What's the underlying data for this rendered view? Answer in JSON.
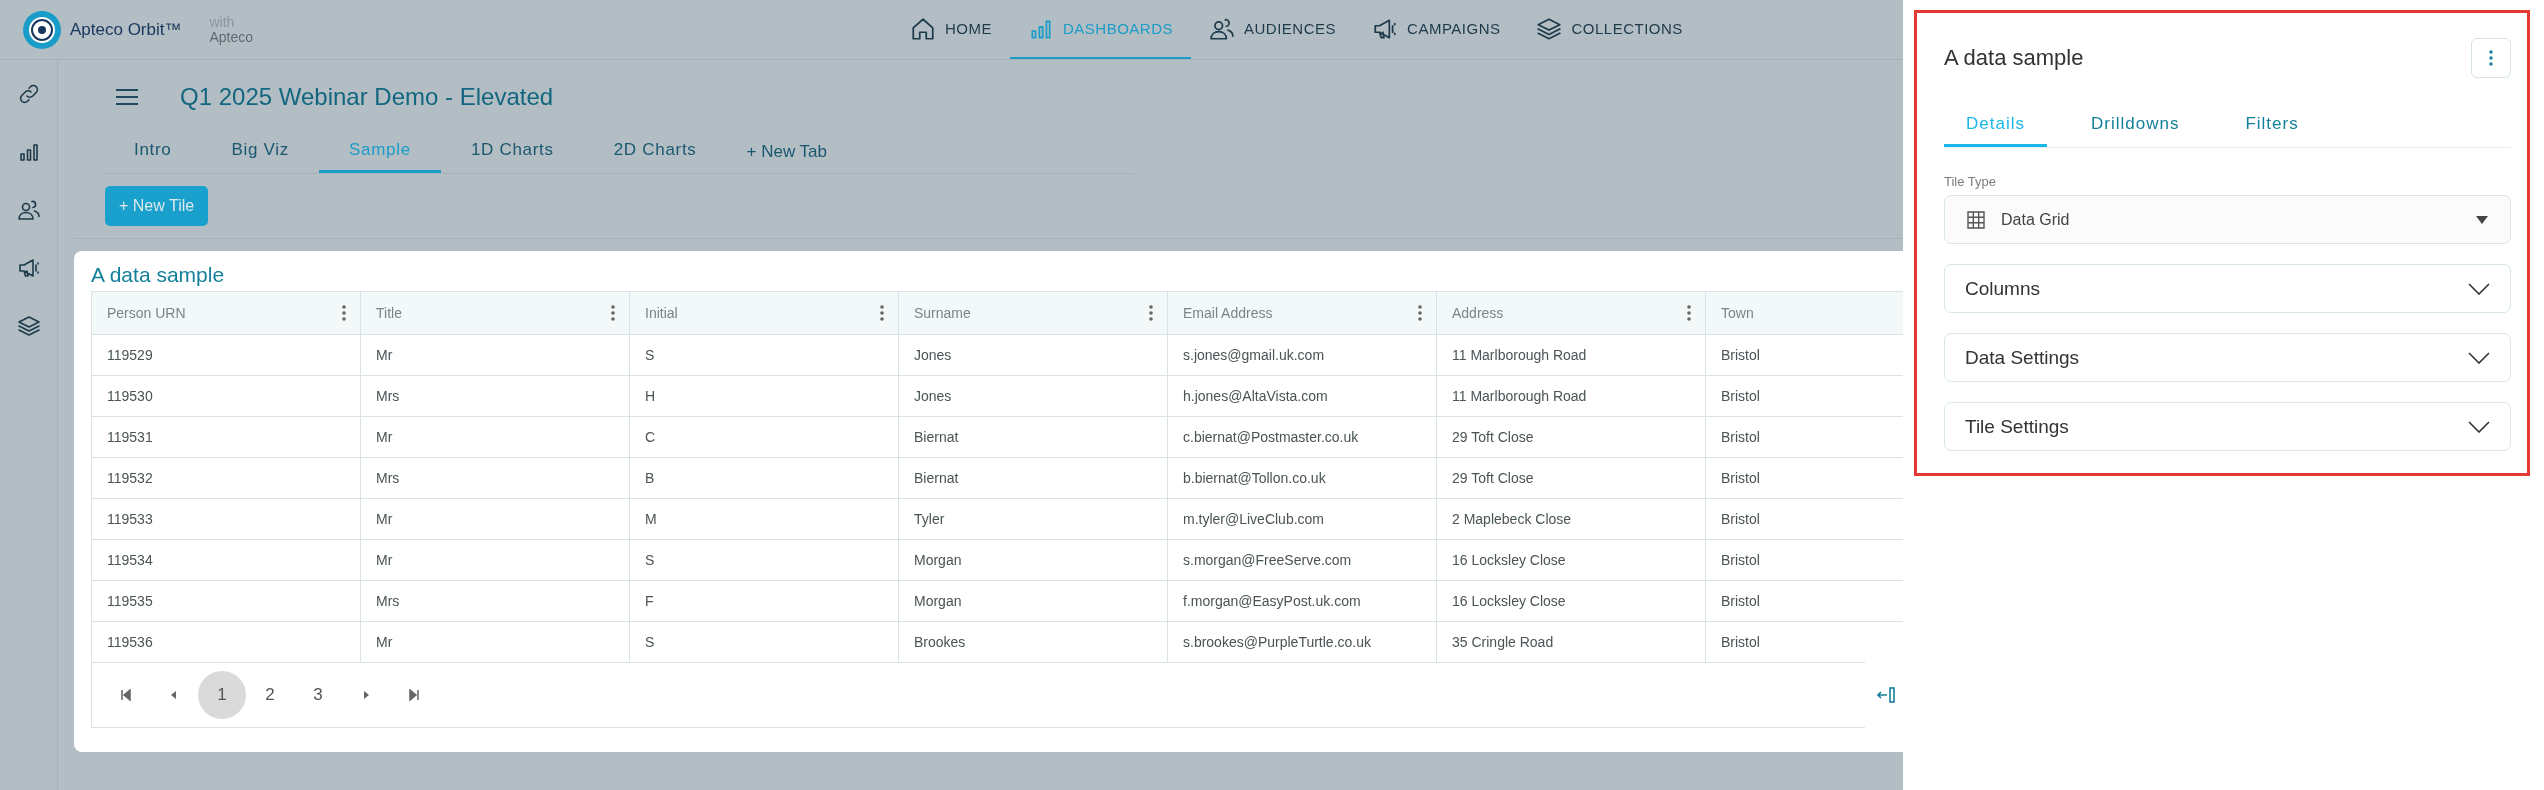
{
  "app": {
    "name": "Apteco Orbit™",
    "with_label": "with",
    "with_brand": "Apteco"
  },
  "nav": [
    {
      "label": "HOME",
      "selected": false
    },
    {
      "label": "DASHBOARDS",
      "selected": true
    },
    {
      "label": "AUDIENCES",
      "selected": false
    },
    {
      "label": "CAMPAIGNS",
      "selected": false
    },
    {
      "label": "COLLECTIONS",
      "selected": false
    }
  ],
  "dashboard": {
    "title": "Q1 2025 Webinar Demo - Elevated",
    "tabs": [
      {
        "label": "Intro",
        "selected": false
      },
      {
        "label": "Big Viz",
        "selected": false
      },
      {
        "label": "Sample",
        "selected": true
      },
      {
        "label": "1D Charts",
        "selected": false
      },
      {
        "label": "2D Charts",
        "selected": false
      }
    ],
    "new_tab": "+ New Tab",
    "new_tile_button": "+ New Tile"
  },
  "tile": {
    "title": "A data sample",
    "columns": [
      {
        "label": "Person URN",
        "menu": true
      },
      {
        "label": "Title",
        "menu": true
      },
      {
        "label": "Initial",
        "menu": true
      },
      {
        "label": "Surname",
        "menu": true
      },
      {
        "label": "Email Address",
        "menu": true
      },
      {
        "label": "Address",
        "menu": true
      },
      {
        "label": "Town",
        "menu": false
      }
    ],
    "rows": [
      [
        "119529",
        "Mr",
        "S",
        "Jones",
        "s.jones@gmail.uk.com",
        "11 Marlborough Road",
        "Bristol"
      ],
      [
        "119530",
        "Mrs",
        "H",
        "Jones",
        "h.jones@AltaVista.com",
        "11 Marlborough Road",
        "Bristol"
      ],
      [
        "119531",
        "Mr",
        "C",
        "Biernat",
        "c.biernat@Postmaster.co.uk",
        "29 Toft Close",
        "Bristol"
      ],
      [
        "119532",
        "Mrs",
        "B",
        "Biernat",
        "b.biernat@Tollon.co.uk",
        "29 Toft Close",
        "Bristol"
      ],
      [
        "119533",
        "Mr",
        "M",
        "Tyler",
        "m.tyler@LiveClub.com",
        "2 Maplebeck Close",
        "Bristol"
      ],
      [
        "119534",
        "Mr",
        "S",
        "Morgan",
        "s.morgan@FreeServe.com",
        "16 Locksley Close",
        "Bristol"
      ],
      [
        "119535",
        "Mrs",
        "F",
        "Morgan",
        "f.morgan@EasyPost.uk.com",
        "16 Locksley Close",
        "Bristol"
      ],
      [
        "119536",
        "Mr",
        "S",
        "Brookes",
        "s.brookes@PurpleTurtle.co.uk",
        "35 Cringle Road",
        "Bristol"
      ]
    ],
    "pages": [
      {
        "label": "1",
        "selected": true
      },
      {
        "label": "2",
        "selected": false
      },
      {
        "label": "3",
        "selected": false
      }
    ]
  },
  "panel": {
    "title": "A data sample",
    "tabs": [
      {
        "label": "Details",
        "selected": true
      },
      {
        "label": "Drilldowns",
        "selected": false
      },
      {
        "label": "Filters",
        "selected": false
      }
    ],
    "tile_type": {
      "label": "Tile Type",
      "value": "Data Grid"
    },
    "sections": [
      {
        "label": "Columns",
        "expanded": false
      },
      {
        "label": "Data Settings",
        "expanded": false
      },
      {
        "label": "Tile Settings",
        "expanded": false
      }
    ]
  }
}
